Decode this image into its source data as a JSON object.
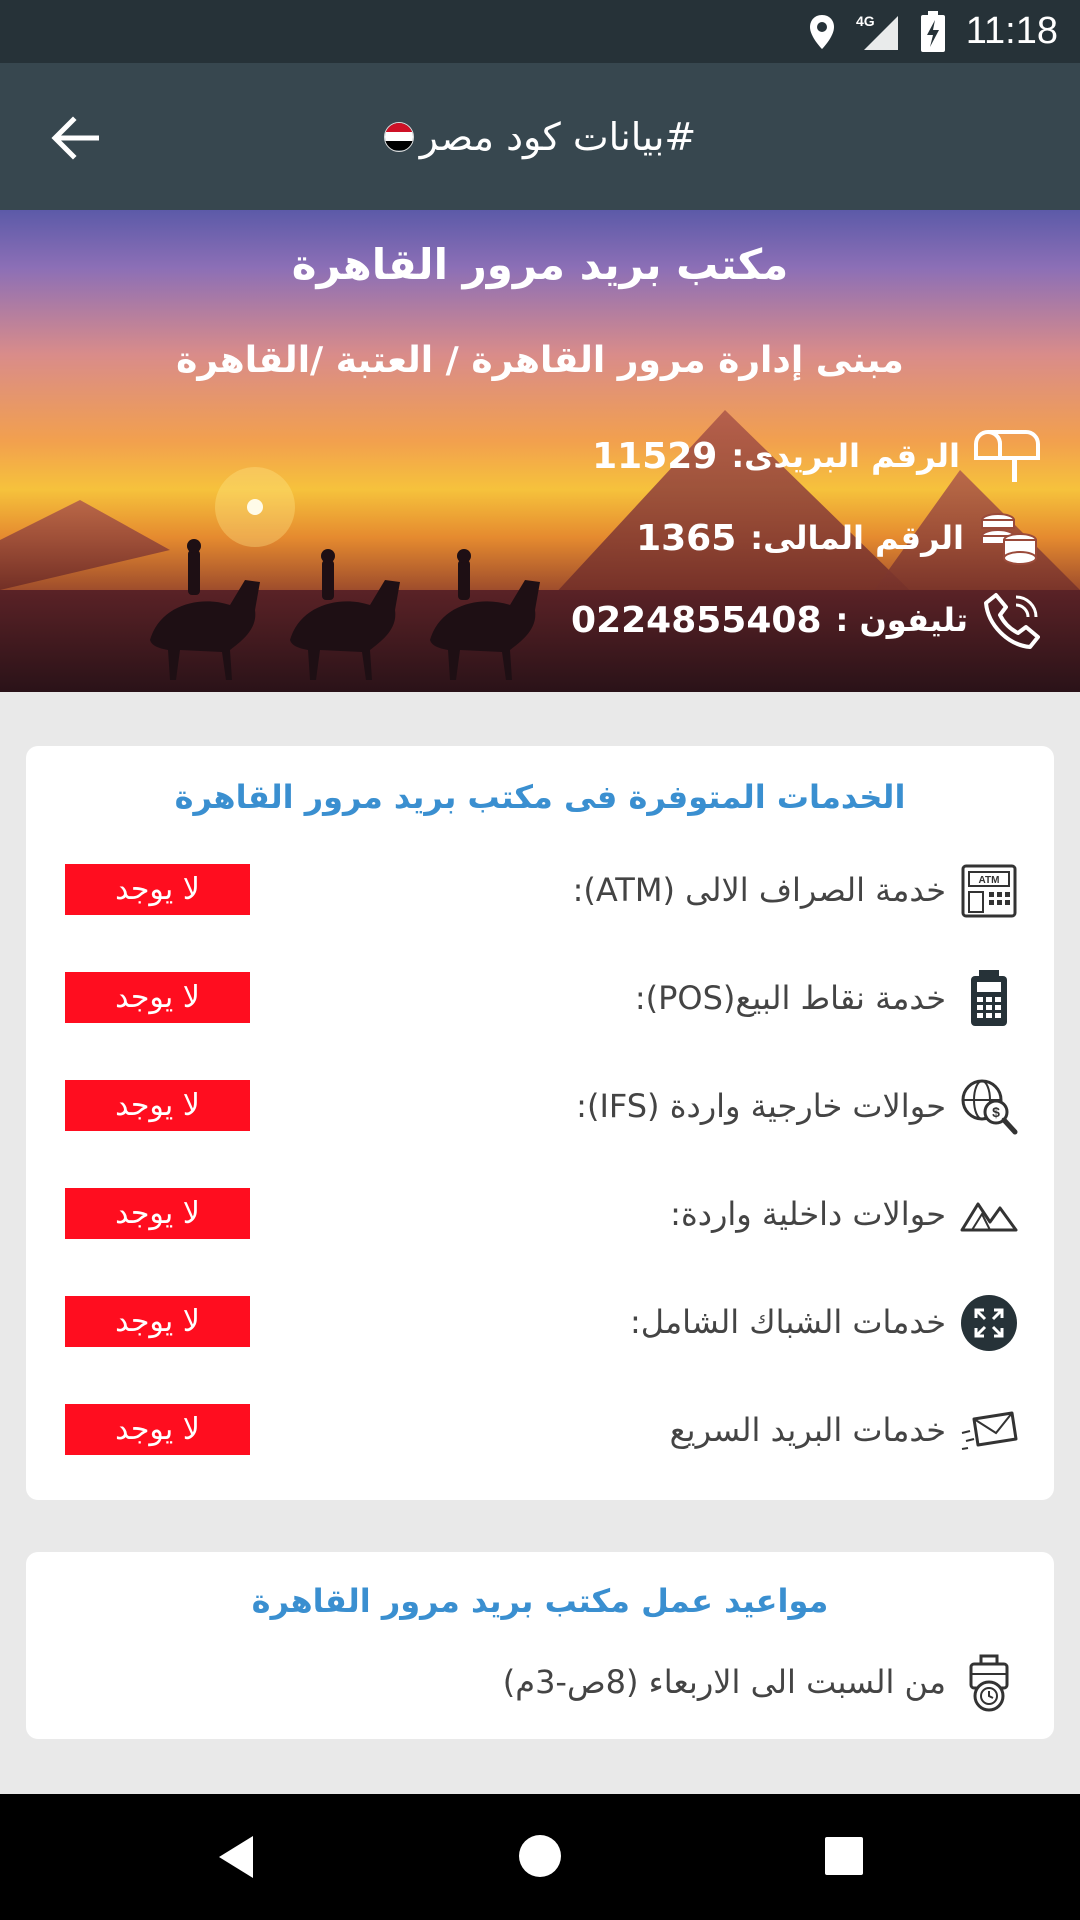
{
  "status_bar": {
    "time": "11:18",
    "network": "4G",
    "icons": [
      "location-icon",
      "signal-icon",
      "battery-charging-icon"
    ]
  },
  "app_bar": {
    "title": "#بيانات كود مصر",
    "back_icon": "arrow-back-icon",
    "flag_colors": [
      "#ce1126",
      "#ffffff",
      "#000000"
    ]
  },
  "hero": {
    "office_name": "مكتب بريد مرور القاهرة",
    "address": "مبنى إدارة مرور القاهرة / العتبة /القاهرة",
    "postal_code_label": "الرقم البريدى:",
    "postal_code": "11529",
    "financial_code_label": "الرقم المالى:",
    "financial_code": "1365",
    "phone_label": "تليفون :",
    "phone": "0224855408"
  },
  "services": {
    "title": "الخدمات المتوفرة فى  مكتب بريد مرور القاهرة",
    "items": [
      {
        "label": "خدمة الصراف الالى (ATM):",
        "status": "لا يوجد",
        "icon": "atm-icon"
      },
      {
        "label": "خدمة نقاط البيع(POS):",
        "status": "لا يوجد",
        "icon": "pos-terminal-icon"
      },
      {
        "label": "حوالات خارجية واردة (IFS):",
        "status": "لا يوجد",
        "icon": "globe-money-icon"
      },
      {
        "label": "حوالات داخلية واردة:",
        "status": "لا يوجد",
        "icon": "mountains-icon"
      },
      {
        "label": "خدمات الشباك الشامل:",
        "status": "لا يوجد",
        "icon": "expand-arrows-icon"
      },
      {
        "label": "خدمات البريد السريع",
        "status": "لا يوجد",
        "icon": "fast-mail-icon"
      }
    ],
    "badge_color": "#ff0d1f",
    "title_color": "#3a8fd0"
  },
  "hours": {
    "title": "مواعيد عمل  مكتب بريد مرور القاهرة",
    "text": "من السبت الى الاربعاء (8ص-3م)",
    "icon": "briefcase-clock-icon"
  },
  "nav_bar": {
    "icons": [
      "back-triangle-icon",
      "home-circle-icon",
      "recents-square-icon"
    ]
  }
}
